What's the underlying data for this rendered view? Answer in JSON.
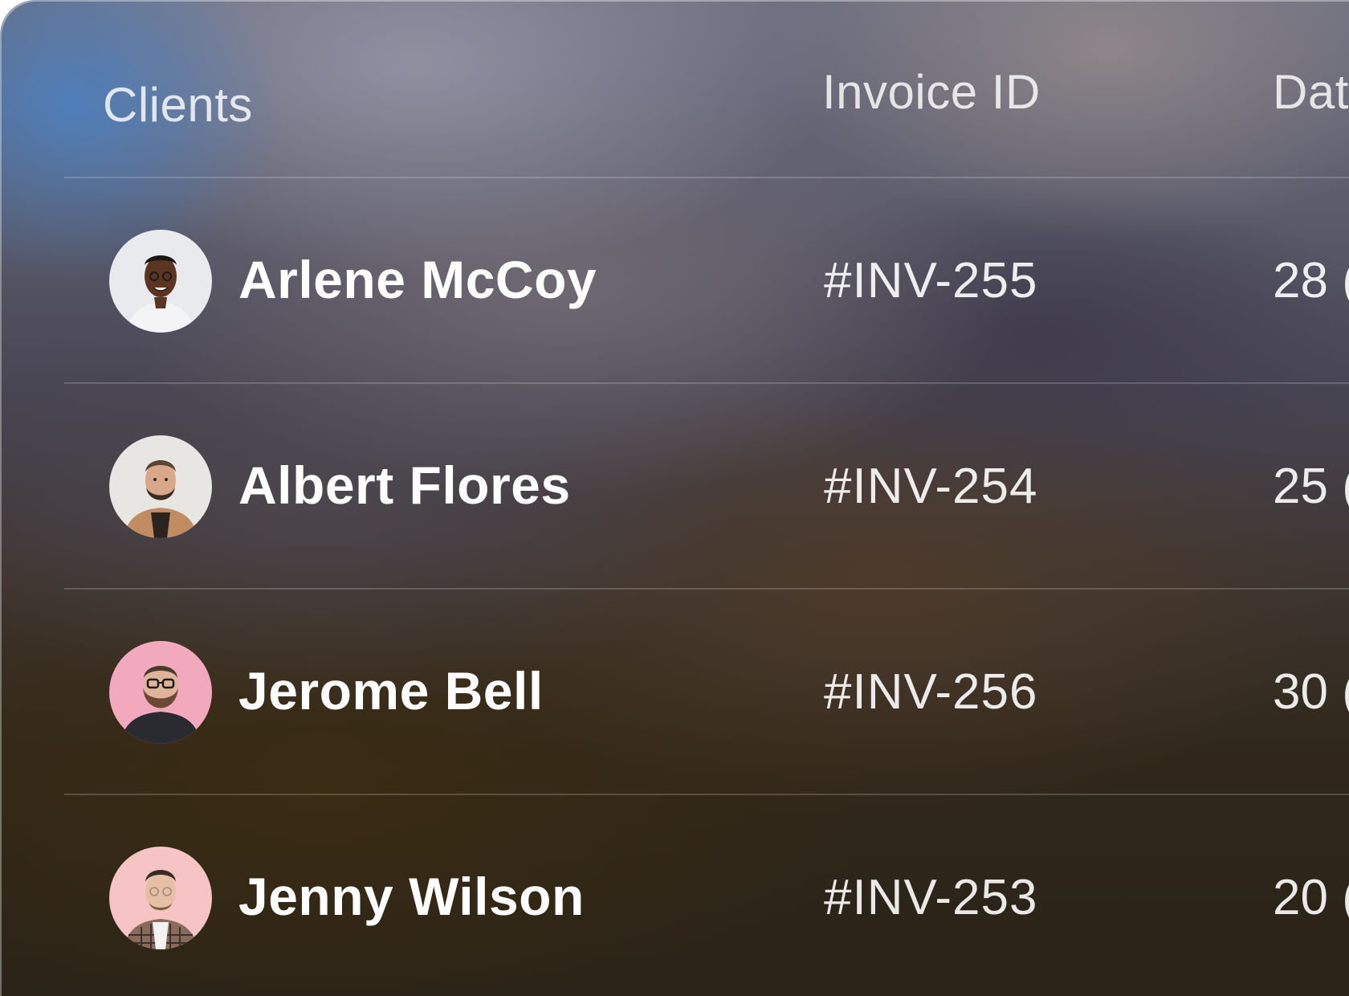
{
  "table": {
    "headers": {
      "clients": "Clients",
      "invoice_id": "Invoice ID",
      "date": "Dat"
    },
    "rows": [
      {
        "client": "Arlene McCoy",
        "invoice": "#INV-255",
        "date": "28 (",
        "avatar_bg": "#e8eaed"
      },
      {
        "client": "Albert Flores",
        "invoice": "#INV-254",
        "date": "25 (",
        "avatar_bg": "#e8e6e3"
      },
      {
        "client": "Jerome Bell",
        "invoice": "#INV-256",
        "date": "30 (",
        "avatar_bg": "#f2a9be"
      },
      {
        "client": "Jenny Wilson",
        "invoice": "#INV-253",
        "date": "20 (",
        "avatar_bg": "#f6c4c4"
      }
    ]
  }
}
